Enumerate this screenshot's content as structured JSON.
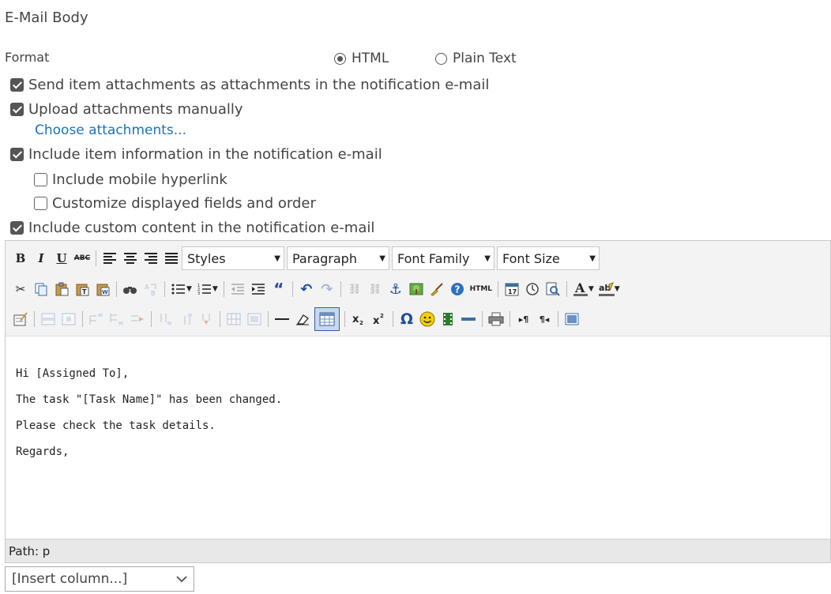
{
  "section_title": "E-Mail Body",
  "format": {
    "label": "Format",
    "options": [
      {
        "label": "HTML",
        "selected": true
      },
      {
        "label": "Plain Text",
        "selected": false
      }
    ]
  },
  "options": {
    "send_attachments": {
      "label": "Send item attachments as attachments in the notification e-mail",
      "checked": true
    },
    "upload_manually": {
      "label": "Upload attachments manually",
      "checked": true
    },
    "choose_attachments_link": "Choose attachments...",
    "include_item_info": {
      "label": "Include item information in the notification e-mail",
      "checked": true
    },
    "include_mobile_link": {
      "label": "Include mobile hyperlink",
      "checked": false
    },
    "customize_fields": {
      "label": "Customize displayed fields and order",
      "checked": false
    },
    "include_custom_content": {
      "label": "Include custom content in the notification e-mail",
      "checked": true
    }
  },
  "editor": {
    "toolbar": {
      "bold": "B",
      "italic": "I",
      "underline": "U",
      "strike": "ABC",
      "styles_combo": "Styles",
      "format_combo": "Paragraph",
      "font_family_combo": "Font Family",
      "font_size_combo": "Font Size",
      "html_button": "HTML"
    },
    "body_lines": [
      "Hi [Assigned To],",
      "The task \"[Task Name]\" has been changed.",
      "Please check the task details.",
      "Regards,"
    ],
    "path_label": "Path: p"
  },
  "insert_column": {
    "selected": "[Insert column...]"
  },
  "colors": {
    "link": "#1a73b8",
    "checkbox": "#555555",
    "toolbar_bg": "#f3f3f3",
    "statusbar_bg": "#e8e8e8"
  }
}
